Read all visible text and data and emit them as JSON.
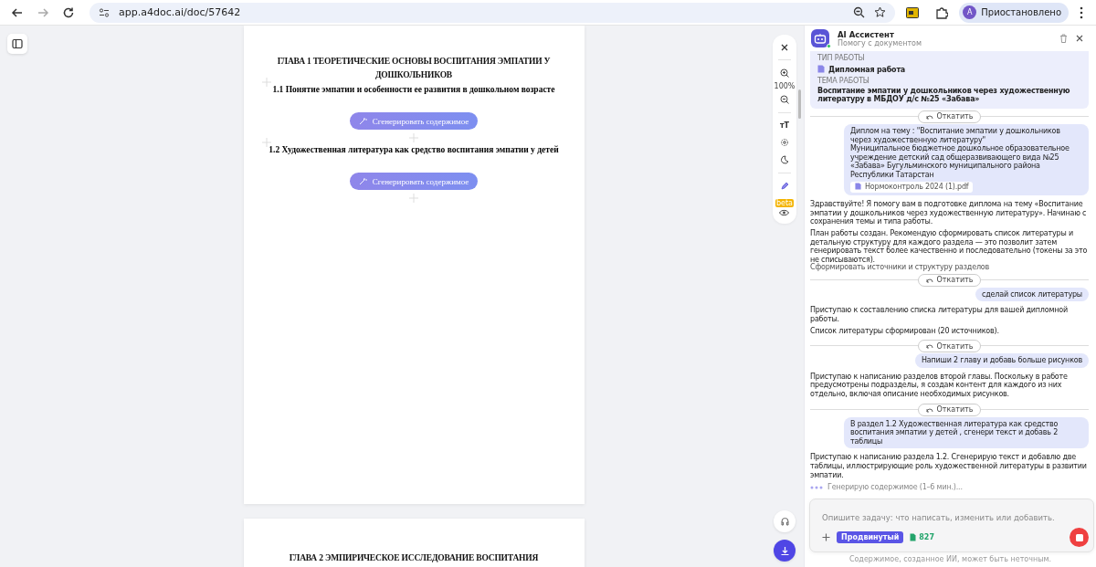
{
  "browser": {
    "url": "app.a4doc.ai/doc/57642",
    "profile_initial": "A",
    "profile_status": "Приостановлено"
  },
  "document": {
    "pages": [
      {
        "blocks": [
          {
            "kind": "chapter",
            "text": "ГЛАВА 1 ТЕОРЕТИЧЕСКИЕ ОСНОВЫ ВОСПИТАНИЯ ЭМПАТИИ У ДОШКОЛЬНИКОВ"
          },
          {
            "kind": "section",
            "text": "1.1 Понятие эмпатии и особенности ее развития в дошкольном возрасте"
          },
          {
            "kind": "generate",
            "text": "Сгенерировать содержимое"
          },
          {
            "kind": "section",
            "text": "1.2 Художественная литература как средство воспитания эмпатии у детей"
          },
          {
            "kind": "generate",
            "text": "Сгенерировать содержимое"
          }
        ]
      },
      {
        "blocks": [
          {
            "kind": "chapter",
            "text": "ГЛАВА 2 ЭМПИРИЧЕСКОЕ ИССЛЕДОВАНИЕ ВОСПИТАНИЯ"
          }
        ]
      }
    ]
  },
  "toolbar": {
    "zoom": "100%",
    "text_size": "тT",
    "badge": "beta"
  },
  "chat": {
    "title": "AI Ассистент",
    "subtitle": "Помогу с документом",
    "info": {
      "type_label": "ТИП РАБОТЫ",
      "type_value": "Дипломная работа",
      "topic_label": "ТЕМА РАБОТЫ",
      "topic_value": "Воспитание эмпатии у дошкольников через художественную литературу в МБДОУ д/с №25 «Забава»"
    },
    "messages": [
      {
        "kind": "rollback",
        "text": "Откатить"
      },
      {
        "kind": "user",
        "lines": [
          "Диплом на тему : \"Воспитание эмпатии у дошкольников через художественную литературу\"",
          "Муниципальное бюджетное дошкольное образовательное учреждение детский сад общеразвивающего вида №25 «Забава» Бугульминского муниципального района Республики Татарстан"
        ],
        "attachment": "Нормоконтроль 2024 (1).pdf"
      },
      {
        "kind": "assistant",
        "paragraphs": [
          "Здравствуйте! Я помогу вам в подготовке диплома на тему «Воспитание эмпатии у дошкольников через художественную литературу». Начинаю с сохранения темы и типа работы.",
          "План работы создан. Рекомендую сформировать список литературы и детальную структуру для каждого раздела — это позволит затем генерировать текст более качественно и последовательно (токены за это не списываются)."
        ]
      },
      {
        "kind": "link",
        "text": "Сформировать источники и структуру разделов"
      },
      {
        "kind": "rollback",
        "text": "Откатить"
      },
      {
        "kind": "user",
        "lines": [
          "сделай список литературы"
        ]
      },
      {
        "kind": "assistant",
        "paragraphs": [
          "Приступаю к составлению списка литературы для вашей дипломной работы.",
          "Список литературы сформирован (20 источников)."
        ]
      },
      {
        "kind": "rollback",
        "text": "Откатить"
      },
      {
        "kind": "user",
        "lines": [
          "Напиши 2 главу и добавь больше рисунков"
        ]
      },
      {
        "kind": "assistant",
        "paragraphs": [
          "Приступаю к написанию разделов второй главы. Поскольку в работе предусмотрены подразделы, я создам контент для каждого из них отдельно, включая описание необходимых рисунков."
        ]
      },
      {
        "kind": "rollback",
        "text": "Откатить"
      },
      {
        "kind": "user",
        "lines": [
          "В раздел 1.2 Художественная литература как средство воспитания эмпатии у детей , сгенери текст и добавь 2 таблицы"
        ]
      },
      {
        "kind": "assistant",
        "paragraphs": [
          "Приступаю к написанию раздела 1.2. Сгенерирую текст и добавлю две таблицы, иллюстрирующие роль художественной литературы в развитии эмпатии."
        ]
      },
      {
        "kind": "status",
        "text": "Генерирую содержимое (1–6 мин.)..."
      }
    ],
    "input": {
      "placeholder": "Опишите задачу: что написать, изменить или добавить.",
      "mode": "Продвинутый",
      "tokens": "827"
    },
    "disclaimer": "Содержимое, созданное ИИ, может быть неточным."
  }
}
